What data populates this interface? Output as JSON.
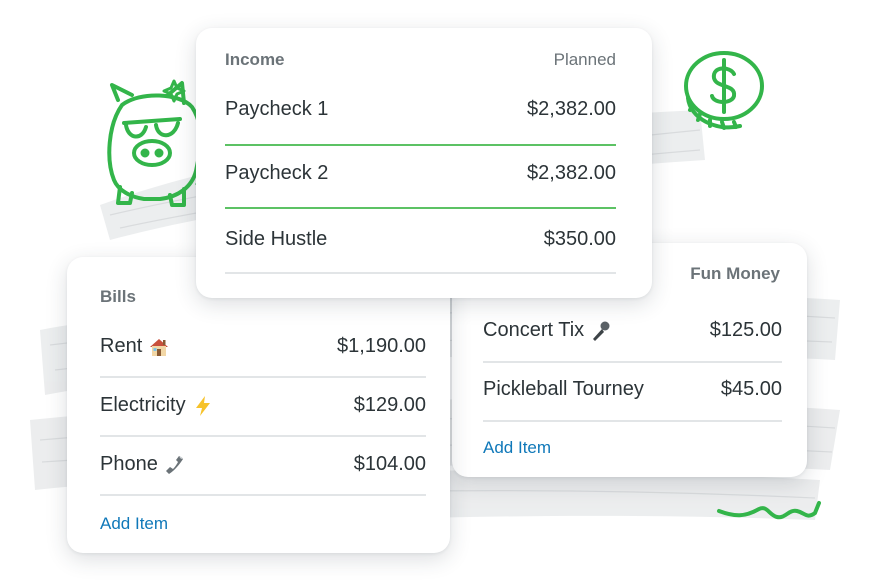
{
  "income": {
    "header": "Income",
    "planned_label": "Planned",
    "items": [
      {
        "name": "Paycheck 1",
        "amount": "$2,382.00"
      },
      {
        "name": "Paycheck 2",
        "amount": "$2,382.00"
      },
      {
        "name": "Side Hustle",
        "amount": "$350.00"
      }
    ]
  },
  "bills": {
    "header": "Bills",
    "items": [
      {
        "name": "Rent",
        "icon": "house-icon",
        "amount": "$1,190.00"
      },
      {
        "name": "Electricity",
        "icon": "lightning-icon",
        "amount": "$129.00"
      },
      {
        "name": "Phone",
        "icon": "phone-icon",
        "amount": "$104.00"
      }
    ],
    "add_label": "Add Item"
  },
  "fun": {
    "header": "Fun Money",
    "items": [
      {
        "name": "Concert Tix",
        "icon": "microphone-icon",
        "amount": "$125.00"
      },
      {
        "name": "Pickleball Tourney",
        "amount": "$45.00"
      }
    ],
    "add_label": "Add Item"
  },
  "colors": {
    "accent_green": "#33b54a",
    "link_blue": "#0f78b9",
    "divider_green": "#5cc264"
  }
}
